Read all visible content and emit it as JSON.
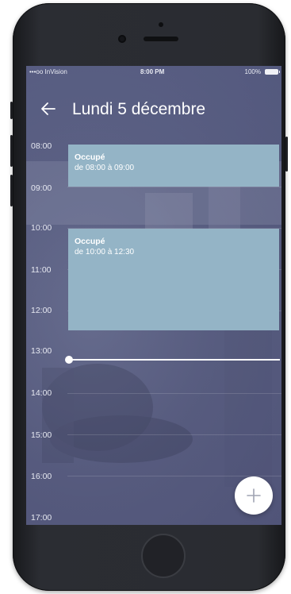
{
  "status_bar": {
    "carrier": "•••oo InVision",
    "time": "8:00 PM",
    "battery": "100%"
  },
  "header": {
    "title": "Lundi 5 décembre",
    "back_icon": "arrow-left-icon"
  },
  "timeline": {
    "hours": [
      "08:00",
      "09:00",
      "10:00",
      "11:00",
      "12:00",
      "13:00",
      "14:00",
      "15:00",
      "16:00",
      "17:00"
    ]
  },
  "events": [
    {
      "title": "Occupé",
      "time": "de 08:00 à 09:00"
    },
    {
      "title": "Occupé",
      "time": "de 10:00 à 12:30"
    }
  ],
  "fab": {
    "icon": "plus-icon"
  },
  "colors": {
    "event": "#94b4c6",
    "overlay": "#5c628a",
    "text": "#ffffff"
  }
}
